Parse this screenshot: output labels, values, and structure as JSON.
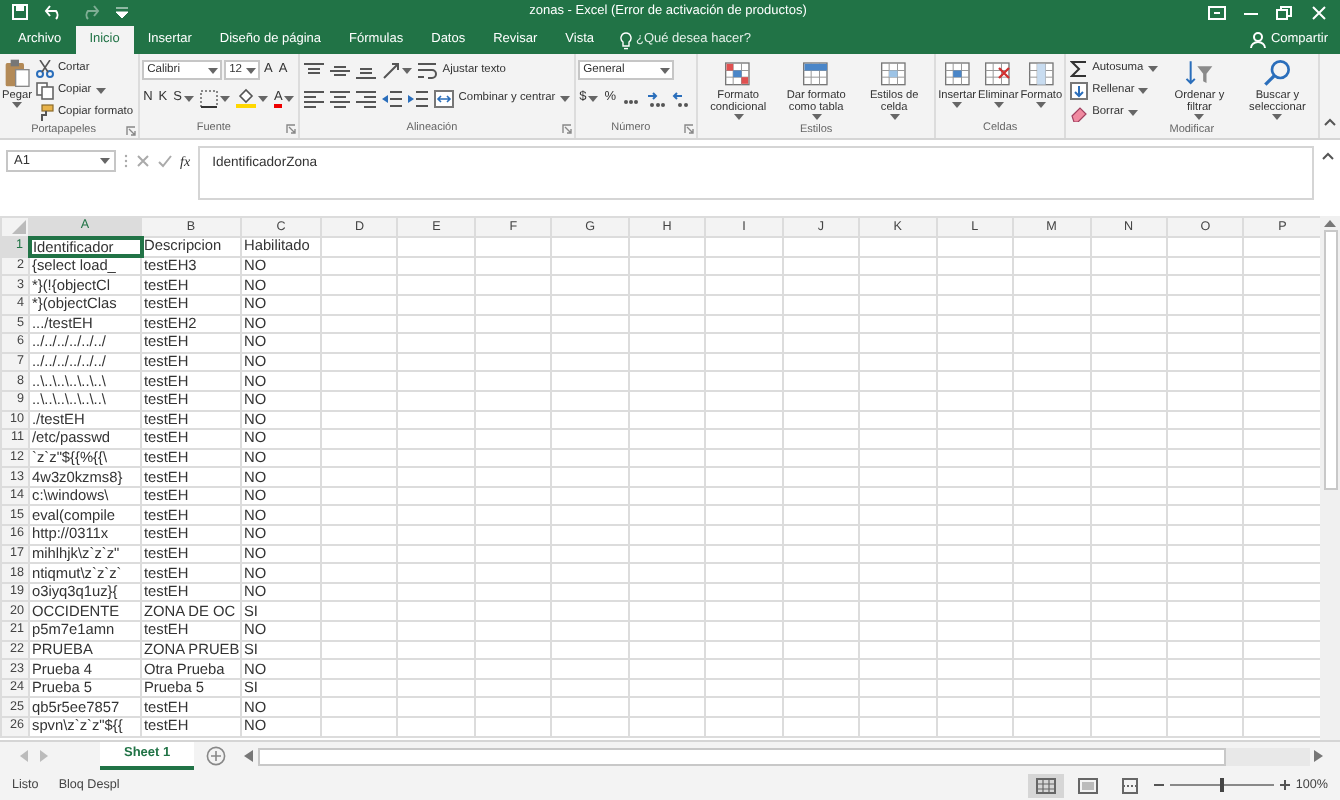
{
  "window": {
    "title": "zonas - Excel (Error de activación de productos)"
  },
  "tabs": [
    {
      "label": "Archivo",
      "selected": false
    },
    {
      "label": "Inicio",
      "selected": true
    },
    {
      "label": "Insertar",
      "selected": false
    },
    {
      "label": "Diseño de página",
      "selected": false
    },
    {
      "label": "Fórmulas",
      "selected": false
    },
    {
      "label": "Datos",
      "selected": false
    },
    {
      "label": "Revisar",
      "selected": false
    },
    {
      "label": "Vista",
      "selected": false
    }
  ],
  "tell_me": {
    "placeholder": "¿Qué desea hacer?"
  },
  "share": {
    "label": "Compartir"
  },
  "ribbon": {
    "groups": [
      {
        "label": "Portapapeles",
        "launcher": true,
        "items": [
          {
            "kind": "large",
            "label": "Pegar",
            "dropdown": true
          },
          {
            "kind": "stack",
            "buttons": [
              {
                "kind": "small",
                "label": "Cortar",
                "dropdown": false
              },
              {
                "kind": "small",
                "label": "Copiar",
                "dropdown": true
              },
              {
                "kind": "small",
                "label": "Copiar formato",
                "dropdown": false
              }
            ]
          }
        ]
      },
      {
        "label": "Fuente",
        "launcher": true,
        "items": [
          {
            "kind": "lines",
            "lines": [
              {
                "controls": [
                  {
                    "kind": "combo",
                    "value": "Calibri"
                  },
                  {
                    "kind": "combo",
                    "value": "12"
                  },
                  {
                    "kind": "text",
                    "label": "A",
                    "dropdown": false
                  },
                  {
                    "kind": "text",
                    "label": "A",
                    "dropdown": false
                  }
                ]
              },
              {
                "controls": [
                  {
                    "kind": "text",
                    "label": "N",
                    "dropdown": false
                  },
                  {
                    "kind": "text",
                    "label": "K",
                    "dropdown": false
                  },
                  {
                    "kind": "text",
                    "label": "S",
                    "dropdown": true
                  },
                  {
                    "kind": "icon",
                    "dropdown": true
                  },
                  {
                    "kind": "icon",
                    "dropdown": true
                  },
                  {
                    "kind": "color_text",
                    "label": "A",
                    "dropdown": true
                  }
                ]
              }
            ]
          }
        ]
      },
      {
        "label": "Alineación",
        "launcher": true,
        "items": [
          {
            "kind": "lines",
            "lines": [
              {
                "controls": [
                  {
                    "kind": "icon",
                    "dropdown": false
                  },
                  {
                    "kind": "icon",
                    "dropdown": false
                  },
                  {
                    "kind": "icon",
                    "dropdown": false
                  },
                  {
                    "kind": "icon",
                    "dropdown": true
                  },
                  {
                    "kind": "small",
                    "label": "Ajustar texto",
                    "dropdown": false
                  }
                ]
              },
              {
                "controls": [
                  {
                    "kind": "icon",
                    "dropdown": false
                  },
                  {
                    "kind": "icon",
                    "dropdown": false
                  },
                  {
                    "kind": "icon",
                    "dropdown": false
                  },
                  {
                    "kind": "icon",
                    "dropdown": false
                  },
                  {
                    "kind": "icon",
                    "dropdown": false
                  },
                  {
                    "kind": "small",
                    "label": "Combinar y centrar",
                    "dropdown": true
                  }
                ]
              }
            ]
          }
        ]
      },
      {
        "label": "Número",
        "launcher": true,
        "items": [
          {
            "kind": "lines",
            "lines": [
              {
                "controls": [
                  {
                    "kind": "combo",
                    "value": "General"
                  }
                ]
              },
              {
                "controls": [
                  {
                    "kind": "text",
                    "label": "$",
                    "dropdown": true
                  },
                  {
                    "kind": "text",
                    "label": "%",
                    "dropdown": false
                  },
                  {
                    "kind": "icon",
                    "dropdown": false
                  },
                  {
                    "kind": "icon",
                    "dropdown": false
                  },
                  {
                    "kind": "icon",
                    "dropdown": false
                  }
                ]
              }
            ]
          }
        ]
      },
      {
        "label": "Estilos",
        "launcher": false,
        "items": [
          {
            "kind": "large",
            "label": "Formato condicional",
            "dropdown": true
          },
          {
            "kind": "large",
            "label": "Dar formato como tabla",
            "dropdown": true
          },
          {
            "kind": "large",
            "label": "Estilos de celda",
            "dropdown": true
          }
        ]
      },
      {
        "label": "Celdas",
        "launcher": false,
        "items": [
          {
            "kind": "large",
            "label": "Insertar",
            "dropdown": true
          },
          {
            "kind": "large",
            "label": "Eliminar",
            "dropdown": true
          },
          {
            "kind": "large",
            "label": "Formato",
            "dropdown": true
          }
        ]
      },
      {
        "label": "Modificar",
        "launcher": false,
        "items": [
          {
            "kind": "stack",
            "buttons": [
              {
                "kind": "small",
                "label": "Autosuma",
                "dropdown": true
              },
              {
                "kind": "small",
                "label": "Rellenar",
                "dropdown": true
              },
              {
                "kind": "small",
                "label": "Borrar",
                "dropdown": true
              }
            ]
          },
          {
            "kind": "large",
            "label": "Ordenar y filtrar",
            "dropdown": true
          },
          {
            "kind": "large",
            "label": "Buscar y seleccionar",
            "dropdown": true
          }
        ]
      }
    ]
  },
  "formula_bar": {
    "name_box": "A1",
    "function_label": "fx",
    "value": "IdentificadorZona"
  },
  "sheet": {
    "columns": [
      {
        "label": "A",
        "selected": true
      },
      {
        "label": "B",
        "selected": false
      },
      {
        "label": "C",
        "selected": false
      },
      {
        "label": "D",
        "selected": false
      },
      {
        "label": "E",
        "selected": false
      },
      {
        "label": "F",
        "selected": false
      },
      {
        "label": "G",
        "selected": false
      },
      {
        "label": "H",
        "selected": false
      },
      {
        "label": "I",
        "selected": false
      },
      {
        "label": "J",
        "selected": false
      },
      {
        "label": "K",
        "selected": false
      },
      {
        "label": "L",
        "selected": false
      },
      {
        "label": "M",
        "selected": false
      },
      {
        "label": "N",
        "selected": false
      },
      {
        "label": "O",
        "selected": false
      },
      {
        "label": "P",
        "selected": false
      }
    ],
    "rows": [
      {
        "number": "1",
        "selected": true,
        "cells": [
          "Identificador",
          "Descripcion",
          "Habilitado"
        ]
      },
      {
        "number": "2",
        "selected": false,
        "cells": [
          "{select load_",
          "testEH3",
          "NO"
        ]
      },
      {
        "number": "3",
        "selected": false,
        "cells": [
          "*}(!{objectCl",
          "testEH",
          "NO"
        ]
      },
      {
        "number": "4",
        "selected": false,
        "cells": [
          "*}(objectClas",
          "testEH",
          "NO"
        ]
      },
      {
        "number": "5",
        "selected": false,
        "cells": [
          ".../testEH",
          "testEH2",
          "NO"
        ]
      },
      {
        "number": "6",
        "selected": false,
        "cells": [
          "../../../../../../",
          "testEH",
          "NO"
        ]
      },
      {
        "number": "7",
        "selected": false,
        "cells": [
          "../../../../../../",
          "testEH",
          "NO"
        ]
      },
      {
        "number": "8",
        "selected": false,
        "cells": [
          "..\\..\\..\\..\\..\\..\\",
          "testEH",
          "NO"
        ]
      },
      {
        "number": "9",
        "selected": false,
        "cells": [
          "..\\..\\..\\..\\..\\..\\",
          "testEH",
          "NO"
        ]
      },
      {
        "number": "10",
        "selected": false,
        "cells": [
          "./testEH",
          "testEH",
          "NO"
        ]
      },
      {
        "number": "11",
        "selected": false,
        "cells": [
          "/etc/passwd",
          "testEH",
          "NO"
        ]
      },
      {
        "number": "12",
        "selected": false,
        "cells": [
          "`z`z\"${{%{{\\",
          "testEH",
          "NO"
        ]
      },
      {
        "number": "13",
        "selected": false,
        "cells": [
          "4w3z0kzms8}",
          "testEH",
          "NO"
        ]
      },
      {
        "number": "14",
        "selected": false,
        "cells": [
          "c:\\windows\\",
          "testEH",
          "NO"
        ]
      },
      {
        "number": "15",
        "selected": false,
        "cells": [
          "eval(compile",
          "testEH",
          "NO"
        ]
      },
      {
        "number": "16",
        "selected": false,
        "cells": [
          "http://0311x",
          "testEH",
          "NO"
        ]
      },
      {
        "number": "17",
        "selected": false,
        "cells": [
          "mihlhjk\\z`z`z\"",
          "testEH",
          "NO"
        ]
      },
      {
        "number": "18",
        "selected": false,
        "cells": [
          "ntiqmut\\z`z`z`",
          "testEH",
          "NO"
        ]
      },
      {
        "number": "19",
        "selected": false,
        "cells": [
          "o3iyq3q1uz}{",
          "testEH",
          "NO"
        ]
      },
      {
        "number": "20",
        "selected": false,
        "cells": [
          "OCCIDENTE",
          "ZONA DE OC",
          "SI"
        ]
      },
      {
        "number": "21",
        "selected": false,
        "cells": [
          "p5m7e1amn",
          "testEH",
          "NO"
        ]
      },
      {
        "number": "22",
        "selected": false,
        "cells": [
          "PRUEBA",
          "ZONA PRUEB",
          "SI"
        ]
      },
      {
        "number": "23",
        "selected": false,
        "cells": [
          "Prueba 4",
          "Otra Prueba",
          "NO"
        ]
      },
      {
        "number": "24",
        "selected": false,
        "cells": [
          "Prueba 5",
          "Prueba 5",
          "SI"
        ]
      },
      {
        "number": "25",
        "selected": false,
        "cells": [
          "qb5r5ee7857",
          "testEH",
          "NO"
        ]
      },
      {
        "number": "26",
        "selected": false,
        "cells": [
          "spvn\\z`z`z\"${{",
          "testEH",
          "NO"
        ]
      }
    ]
  },
  "sheet_tabs": [
    {
      "label": "Sheet 1",
      "selected": true
    }
  ],
  "status_bar": {
    "items": [
      "Listo",
      "Bloq Despl"
    ],
    "views": [
      {
        "kind": "normal",
        "selected": true
      },
      {
        "kind": "page_layout",
        "selected": false
      },
      {
        "kind": "page_break",
        "selected": false
      }
    ],
    "zoom": {
      "level": 0.5,
      "reading": "100%"
    }
  }
}
